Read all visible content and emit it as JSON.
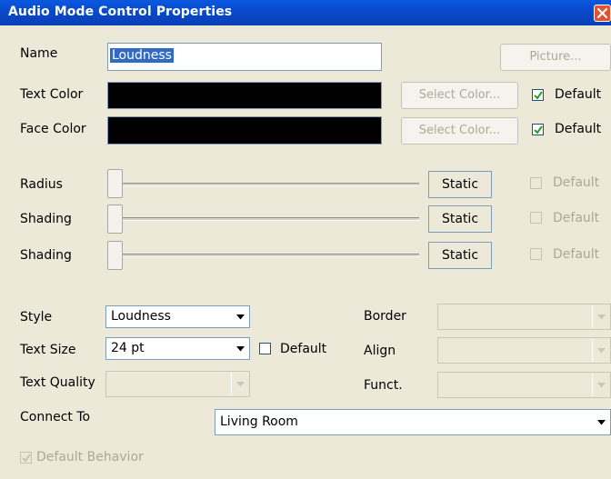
{
  "window": {
    "title": "Audio Mode Control Properties"
  },
  "name": {
    "label": "Name",
    "value": "Loudness",
    "picture_button": "Picture..."
  },
  "text_color": {
    "label": "Text Color",
    "select_button": "Select Color...",
    "default_label": "Default",
    "default_checked": true,
    "color": "#000000"
  },
  "face_color": {
    "label": "Face Color",
    "select_button": "Select Color...",
    "default_label": "Default",
    "default_checked": true,
    "color": "#000000"
  },
  "sliders": [
    {
      "label": "Radius",
      "mode": "Static",
      "default_label": "Default",
      "level": 0
    },
    {
      "label": "Shading",
      "mode": "Static",
      "default_label": "Default",
      "level": 0
    },
    {
      "label": "Shading",
      "mode": "Static",
      "default_label": "Default",
      "level": 0
    }
  ],
  "style": {
    "label": "Style",
    "value": "Loudness"
  },
  "text_size": {
    "label": "Text Size",
    "value": "24 pt",
    "default_label": "Default",
    "default_checked": false
  },
  "text_quality": {
    "label": "Text Quality",
    "value": ""
  },
  "border": {
    "label": "Border",
    "value": ""
  },
  "align": {
    "label": "Align",
    "value": ""
  },
  "funct": {
    "label": "Funct.",
    "value": ""
  },
  "connect_to": {
    "label": "Connect To",
    "value": "Living Room"
  },
  "default_behavior": {
    "label": "Default Behavior",
    "checked": true
  },
  "colors": {
    "title_bar": "#0a4fd6",
    "dialog_bg": "#ece9d8",
    "disabled_text": "#aca899",
    "close_button": "#e1542f"
  }
}
